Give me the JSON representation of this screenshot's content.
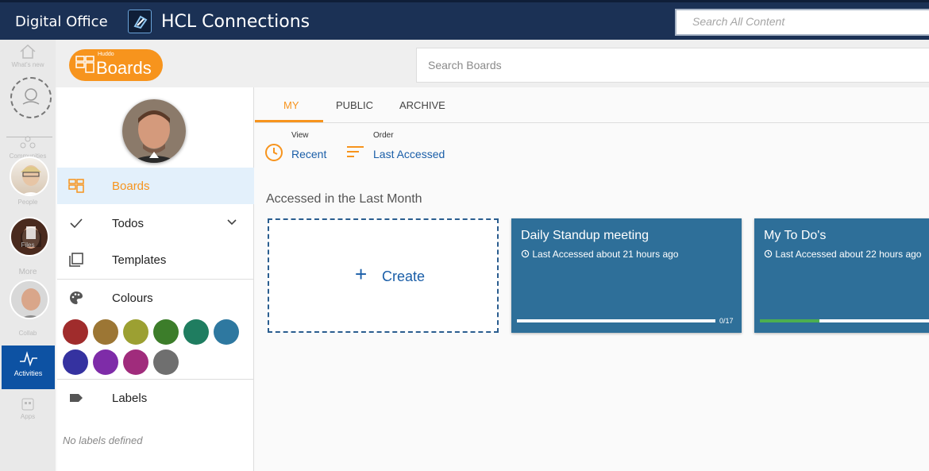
{
  "topbar": {
    "brand": "Digital Office",
    "product": "HCL Connections",
    "search_placeholder": "Search All Content"
  },
  "leftrail": {
    "items": [
      {
        "label": "What's new",
        "icon": "home-icon"
      },
      {
        "label": "Communities",
        "icon": "communities-icon"
      },
      {
        "label": "People",
        "icon": "person-icon"
      },
      {
        "label": "Files",
        "icon": "file-icon"
      },
      {
        "label": "More",
        "icon": "more-icon"
      },
      {
        "label": "Collab",
        "icon": "collab-icon"
      },
      {
        "label": "Activities",
        "icon": "activities-icon"
      },
      {
        "label": "Apps",
        "icon": "apps-icon"
      }
    ]
  },
  "boards_header": {
    "badge_small": "Huddo",
    "badge_big": "Boards",
    "search_placeholder": "Search Boards"
  },
  "sidebar": {
    "menu": [
      {
        "label": "Boards",
        "icon": "boards-icon",
        "selected": true
      },
      {
        "label": "Todos",
        "icon": "check-icon"
      },
      {
        "label": "Templates",
        "icon": "templates-icon"
      },
      {
        "label": "Colours",
        "icon": "palette-icon"
      },
      {
        "label": "Labels",
        "icon": "label-icon"
      }
    ],
    "colours": [
      "#a02c2c",
      "#9c7634",
      "#9ca032",
      "#3c7d2a",
      "#1f7d60",
      "#2e78a0",
      "#3532a0",
      "#7e2ca8",
      "#a02c7c",
      "#6f6f6f"
    ],
    "no_labels": "No labels defined"
  },
  "main": {
    "tabs": [
      "MY",
      "PUBLIC",
      "ARCHIVE"
    ],
    "view_label": "View",
    "view_value": "Recent",
    "order_label": "Order",
    "order_value": "Last Accessed",
    "section_title": "Accessed in the Last Month",
    "create_label": "Create",
    "boards": [
      {
        "title": "Daily Standup meeting",
        "subtitle": "Last Accessed about 21 hours ago",
        "progress": 0,
        "count": "0/17"
      },
      {
        "title": "My To Do's",
        "subtitle": "Last Accessed about 22 hours ago",
        "progress": 0.35,
        "count": ""
      }
    ]
  }
}
